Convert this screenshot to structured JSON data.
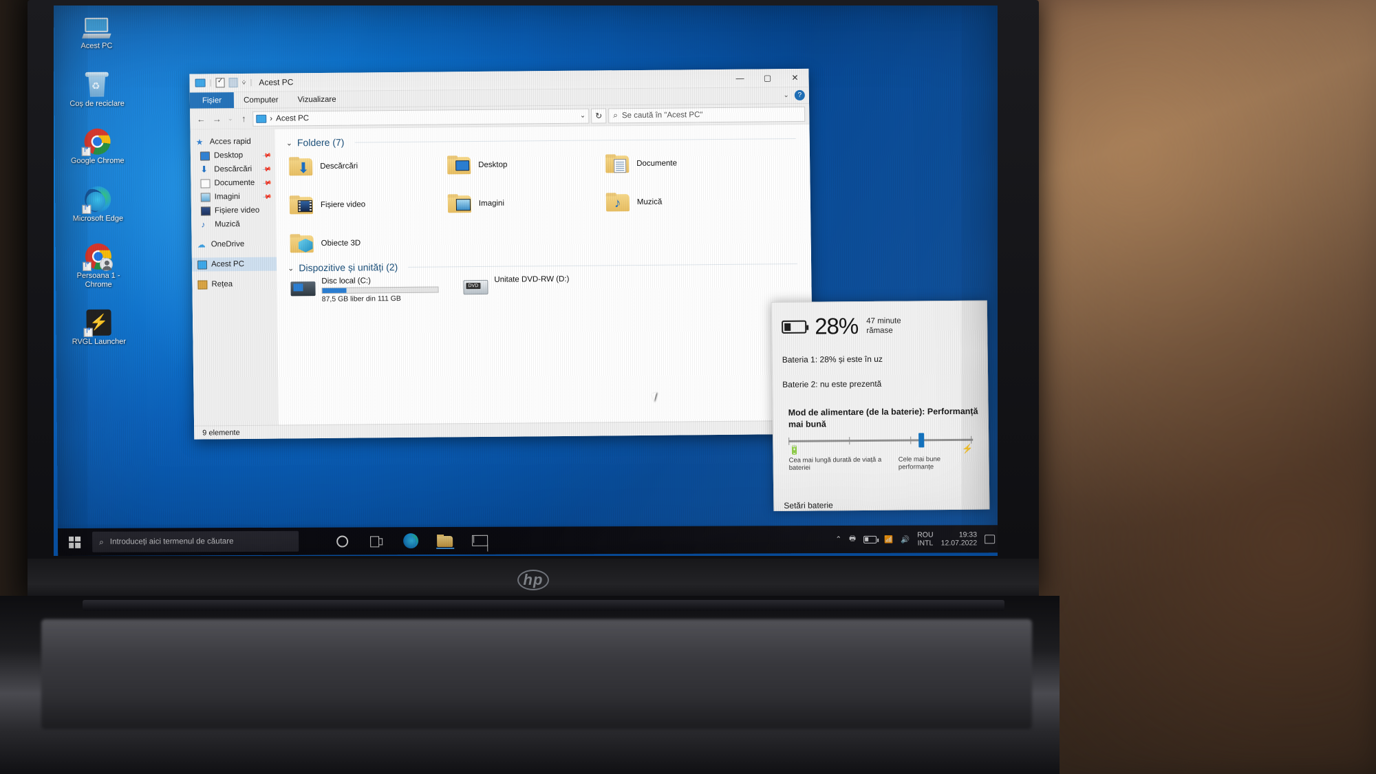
{
  "desktop": {
    "icons": [
      {
        "name": "Acest PC",
        "icon": "computer-icon"
      },
      {
        "name": "Coș de reciclare",
        "icon": "recycle-bin-icon"
      },
      {
        "name": "Google Chrome",
        "icon": "chrome-icon"
      },
      {
        "name": "Microsoft Edge",
        "icon": "edge-icon"
      },
      {
        "name": "Persoana 1 - Chrome",
        "icon": "chrome-person-icon"
      },
      {
        "name": "RVGL Launcher",
        "icon": "rvgl-icon"
      }
    ]
  },
  "explorer": {
    "title": "Acest PC",
    "tabs": {
      "file": "Fișier",
      "computer": "Computer",
      "view": "Vizualizare"
    },
    "window_controls": {
      "minimize": "—",
      "maximize": "▢",
      "close": "✕"
    },
    "nav": {
      "back": "←",
      "forward": "→",
      "recent": "⌄",
      "up": "↑",
      "refresh": "↻"
    },
    "address": {
      "root": "Acest PC",
      "separator": "›",
      "chevron": "⌄"
    },
    "search": {
      "placeholder": "Se caută în \"Acest PC\"",
      "icon": "search-icon"
    },
    "sidebar": [
      {
        "label": "Acces rapid",
        "icon": "star-icon",
        "pinned": false,
        "selected": false,
        "root": true
      },
      {
        "label": "Desktop",
        "icon": "desktop-icon",
        "pinned": true,
        "selected": false,
        "root": false
      },
      {
        "label": "Descărcări",
        "icon": "downloads-icon",
        "pinned": true,
        "selected": false,
        "root": false
      },
      {
        "label": "Documente",
        "icon": "documents-icon",
        "pinned": true,
        "selected": false,
        "root": false
      },
      {
        "label": "Imagini",
        "icon": "pictures-icon",
        "pinned": true,
        "selected": false,
        "root": false
      },
      {
        "label": "Fișiere video",
        "icon": "videos-icon",
        "pinned": false,
        "selected": false,
        "root": false
      },
      {
        "label": "Muzică",
        "icon": "music-icon",
        "pinned": false,
        "selected": false,
        "root": false
      },
      {
        "label": "OneDrive",
        "icon": "cloud-icon",
        "pinned": false,
        "selected": false,
        "root": true
      },
      {
        "label": "Acest PC",
        "icon": "computer-icon",
        "pinned": false,
        "selected": true,
        "root": true
      },
      {
        "label": "Rețea",
        "icon": "network-icon",
        "pinned": false,
        "selected": false,
        "root": true
      }
    ],
    "groups": {
      "folders_header": "Foldere (7)",
      "folders": [
        {
          "label": "Descărcări",
          "emblem": "downloads-emblem"
        },
        {
          "label": "Desktop",
          "emblem": "desktop-emblem"
        },
        {
          "label": "Documente",
          "emblem": "documents-emblem"
        },
        {
          "label": "Fișiere video",
          "emblem": "videos-emblem"
        },
        {
          "label": "Imagini",
          "emblem": "pictures-emblem"
        },
        {
          "label": "Muzică",
          "emblem": "music-emblem"
        },
        {
          "label": "Obiecte 3D",
          "emblem": "3dobjects-emblem"
        }
      ],
      "drives_header": "Dispozitive și unități (2)",
      "drives": [
        {
          "label": "Disc local (C:)",
          "free_text": "87,5 GB liber din 111 GB",
          "used_percent": 21,
          "icon": "hdd-icon"
        },
        {
          "label": "Unitate DVD-RW (D:)",
          "free_text": "",
          "used_percent": 0,
          "icon": "dvd-icon"
        }
      ]
    },
    "status": "9 elemente"
  },
  "battery_flyout": {
    "percent": "28%",
    "remaining": "47 minute\nrămase",
    "remaining_line1": "47 minute",
    "remaining_line2": "rămase",
    "battery1": "Bateria 1: 28% și este în uz",
    "battery2": "Baterie 2: nu este prezentă",
    "power_mode": "Mod de alimentare (de la baterie): Performanță mai bună",
    "slider": {
      "value_percent": 72,
      "left_icon": "battery-saver-icon",
      "right_icon": "performance-icon",
      "left_label": "Cea mai lungă durată de viață a bateriei",
      "right_label": "Cele mai bune performanțe"
    },
    "settings_link": "Setări baterie",
    "fill_percent": 28
  },
  "taskbar": {
    "start_icon": "windows-logo-icon",
    "search_placeholder": "Introduceți aici termenul de căutare",
    "search_icon": "search-icon",
    "items": [
      {
        "name": "cortana-icon",
        "label": "Cortana"
      },
      {
        "name": "task-view-icon",
        "label": "Vizualizare activități"
      },
      {
        "name": "edge-icon",
        "label": "Microsoft Edge"
      },
      {
        "name": "file-explorer-icon",
        "label": "Explorer",
        "active": true
      },
      {
        "name": "mail-icon",
        "label": "Mail"
      }
    ],
    "tray": {
      "chevron": "⌃",
      "icons": [
        "printer-icon",
        "battery-icon",
        "wifi-icon",
        "volume-icon"
      ],
      "language_line1": "ROU",
      "language_line2": "INTL",
      "time": "19:33",
      "date": "12.07.2022",
      "notification_icon": "notification-icon"
    }
  },
  "hardware": {
    "brand": "hp"
  },
  "colors": {
    "accent": "#0a6ebd",
    "wallpaper": "#0c73cf",
    "ribbon_file": "#1f6fb8",
    "taskbar": "#0d0d14"
  }
}
